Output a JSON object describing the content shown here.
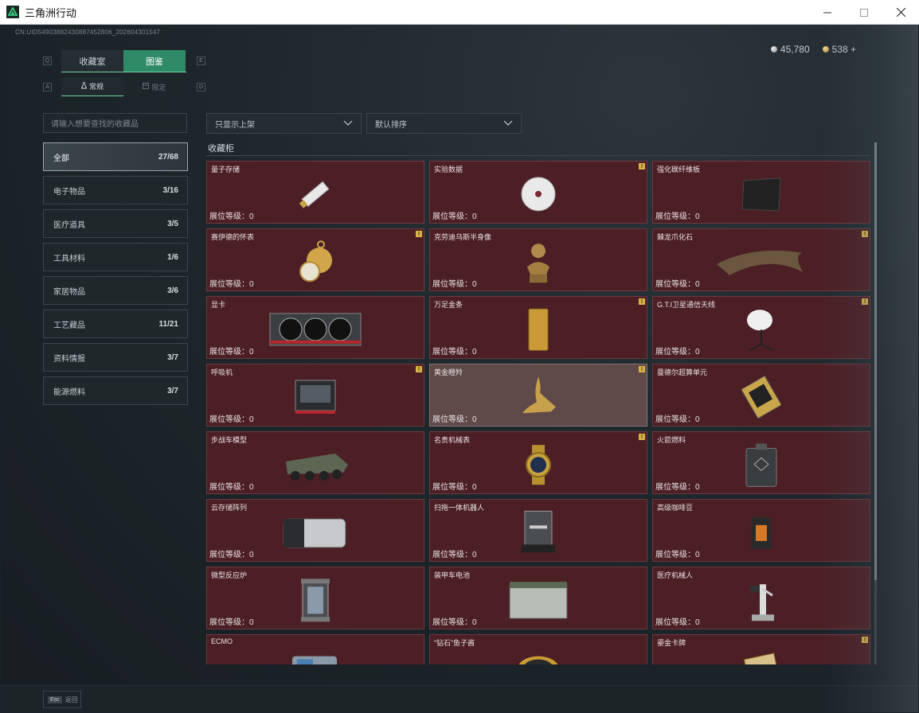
{
  "window": {
    "title": "三角洲行动",
    "minimize_icon": "minimize-icon",
    "maximize_icon": "maximize-icon",
    "close_icon": "close-icon"
  },
  "header": {
    "uid": "CN:UID5490388243088745280​6_202604301547",
    "currency": [
      {
        "icon": "silver-coin-icon",
        "value": "45,780"
      },
      {
        "icon": "gold-coin-icon",
        "value": "538 +"
      }
    ]
  },
  "tabs": {
    "key_left": "Q",
    "key_right": "E",
    "items": [
      {
        "label": "收藏室",
        "active": false
      },
      {
        "label": "图鉴",
        "active": true
      }
    ]
  },
  "subtabs": {
    "key_left": "A",
    "key_right": "D",
    "items": [
      {
        "label": "常规",
        "icon": "flask-icon",
        "active": true
      },
      {
        "label": "限定",
        "icon": "box-icon",
        "active": false
      }
    ]
  },
  "search": {
    "placeholder": "请输入想要查找的收藏品"
  },
  "categories": [
    {
      "label": "全部",
      "count": "27/68",
      "active": true
    },
    {
      "label": "电子物品",
      "count": "3/16"
    },
    {
      "label": "医疗道具",
      "count": "3/5"
    },
    {
      "label": "工具材料",
      "count": "1/6"
    },
    {
      "label": "家居物品",
      "count": "3/6"
    },
    {
      "label": "工艺藏品",
      "count": "11/21"
    },
    {
      "label": "资料情报",
      "count": "3/7"
    },
    {
      "label": "能源燃料",
      "count": "3/7"
    }
  ],
  "filters": {
    "filter_label": "只显示上架",
    "sort_label": "默认排序"
  },
  "section": {
    "title": "收藏柜"
  },
  "cards": [
    {
      "name": "量子存储",
      "level": "展位等级：0",
      "badge": false,
      "art": "usb-drive-icon"
    },
    {
      "name": "实验数据",
      "level": "展位等级：0",
      "badge": true,
      "art": "disc-icon"
    },
    {
      "name": "强化碳纤维板",
      "level": "展位等级：0",
      "badge": false,
      "art": "carbon-plate-icon"
    },
    {
      "name": "赛伊德的怀表",
      "level": "展位等级：0",
      "badge": true,
      "art": "pocket-watch-icon"
    },
    {
      "name": "克劳迪乌斯半身像",
      "level": "展位等级：0",
      "badge": false,
      "art": "bust-icon"
    },
    {
      "name": "棘龙爪化石",
      "level": "展位等级：0",
      "badge": true,
      "art": "claw-fossil-icon"
    },
    {
      "name": "显卡",
      "level": "展位等级：0",
      "badge": false,
      "art": "graphics-card-icon"
    },
    {
      "name": "万足金条",
      "level": "展位等级：0",
      "badge": true,
      "art": "gold-bar-icon"
    },
    {
      "name": "G.T.I卫星通信天线",
      "level": "展位等级：0",
      "badge": true,
      "art": "satellite-dish-icon"
    },
    {
      "name": "呼吸机",
      "level": "展位等级：0",
      "badge": true,
      "art": "ventilator-icon"
    },
    {
      "name": "黄金瞪羚",
      "level": "展位等级：0",
      "badge": true,
      "art": "gazelle-statue-icon",
      "highlight": true
    },
    {
      "name": "曼德尔超算单元",
      "level": "展位等级：0",
      "badge": false,
      "art": "cpu-board-icon"
    },
    {
      "name": "步战车模型",
      "level": "展位等级：0",
      "badge": false,
      "art": "ifv-model-icon"
    },
    {
      "name": "名贵机械表",
      "level": "展位等级：0",
      "badge": true,
      "art": "wristwatch-icon"
    },
    {
      "name": "火箭燃料",
      "level": "展位等级：0",
      "badge": false,
      "art": "fuel-canister-icon"
    },
    {
      "name": "云存储阵列",
      "level": "展位等级：0",
      "badge": false,
      "art": "storage-array-icon"
    },
    {
      "name": "扫拖一体机器人",
      "level": "展位等级：0",
      "badge": false,
      "art": "robot-vacuum-station-icon"
    },
    {
      "name": "高级咖啡豆",
      "level": "展位等级：0",
      "badge": false,
      "art": "coffee-bag-icon"
    },
    {
      "name": "微型反应炉",
      "level": "展位等级：0",
      "badge": false,
      "art": "reactor-icon"
    },
    {
      "name": "装甲车电池",
      "level": "展位等级：0",
      "badge": false,
      "art": "battery-icon"
    },
    {
      "name": "医疗机械人",
      "level": "展位等级：0",
      "badge": false,
      "art": "medical-robot-icon"
    },
    {
      "name": "ECMO",
      "level": "",
      "badge": false,
      "art": "ecmo-icon"
    },
    {
      "name": "“钻石”鱼子酱",
      "level": "",
      "badge": false,
      "art": "caviar-tin-icon"
    },
    {
      "name": "鎏金卡牌",
      "level": "",
      "badge": true,
      "art": "gilded-card-icon"
    }
  ],
  "footer": {
    "esc_key": "Esc",
    "back_label": "返回"
  }
}
